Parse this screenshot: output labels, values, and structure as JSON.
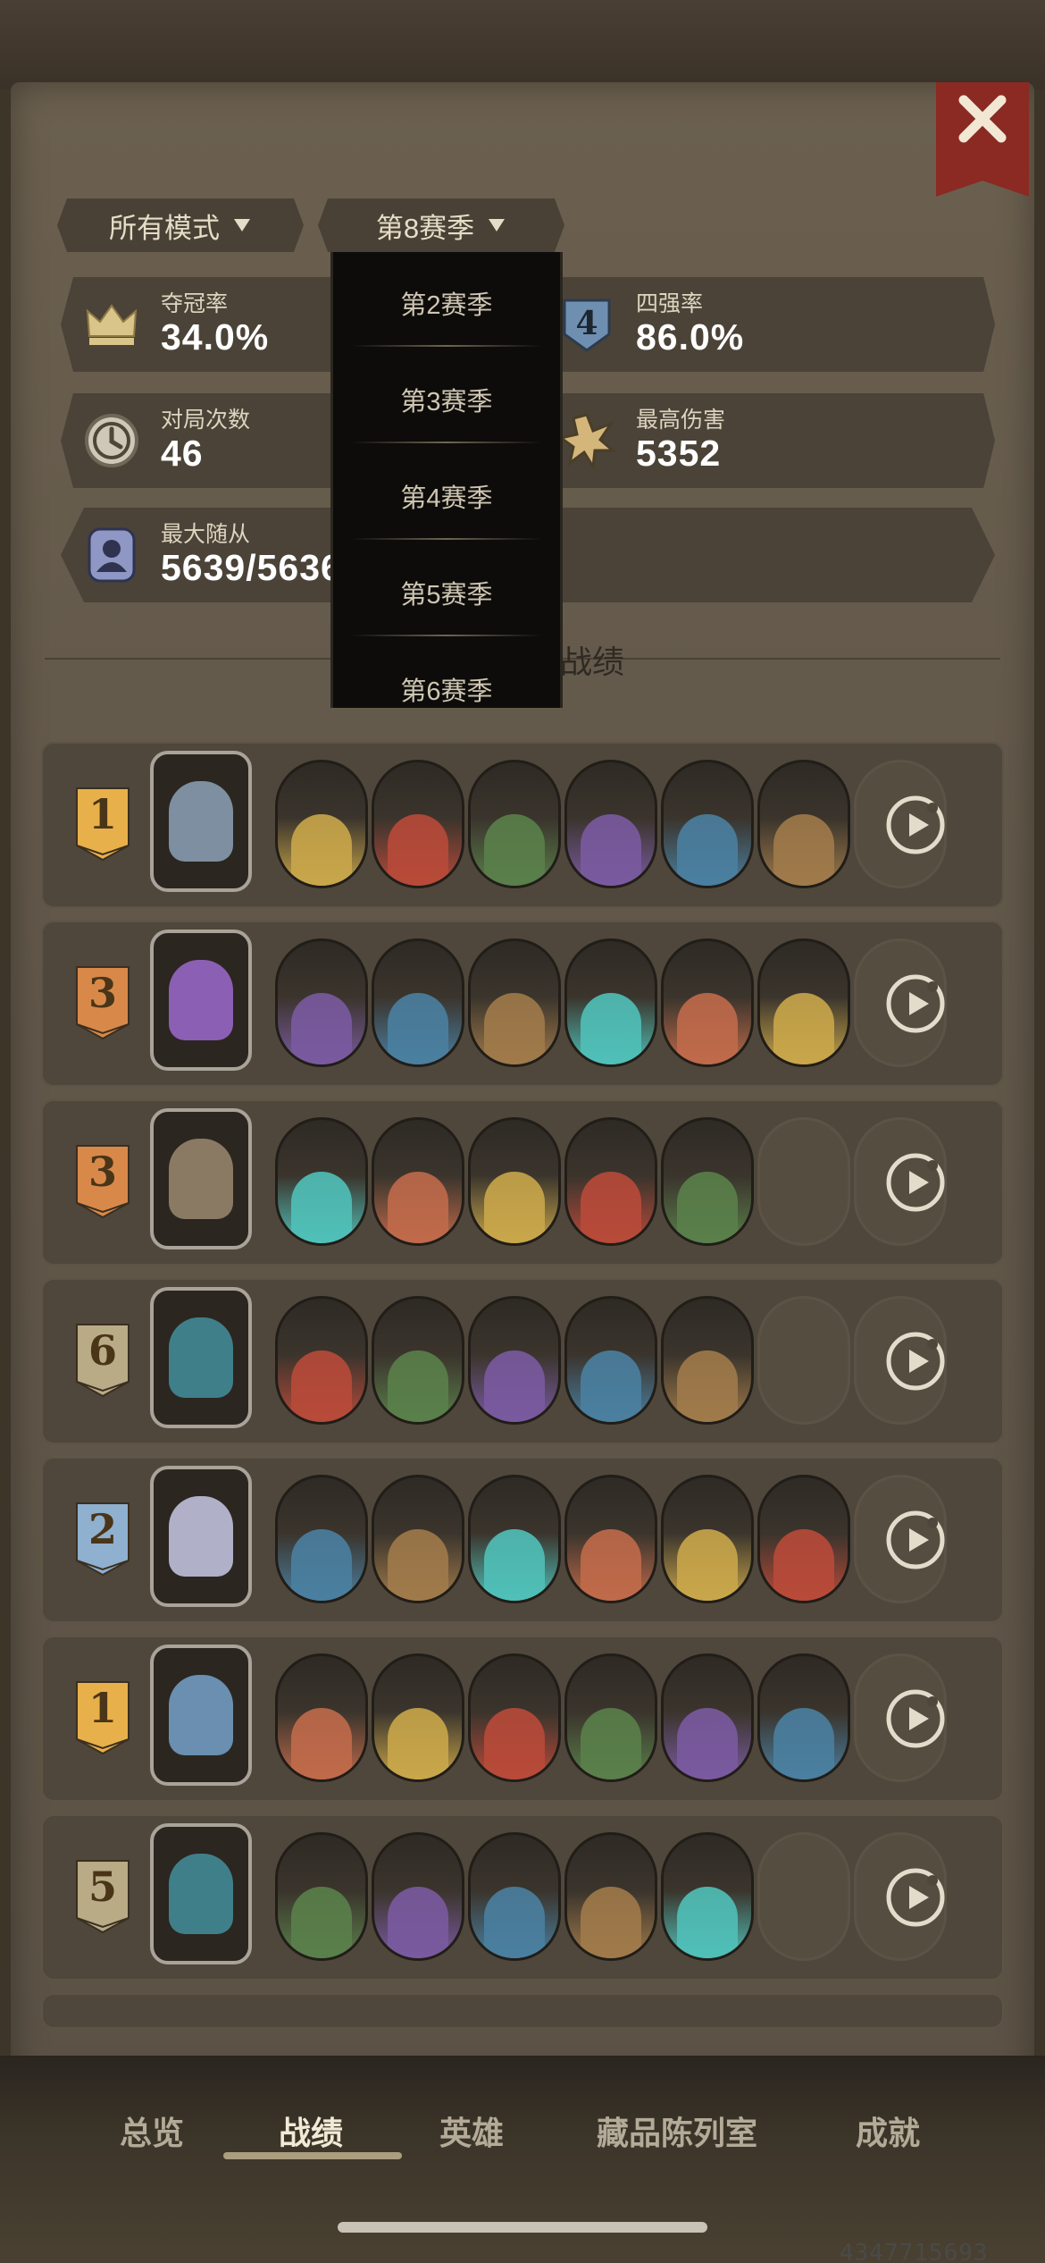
{
  "filters": {
    "mode_label": "所有模式",
    "season_label": "第8赛季"
  },
  "stats": {
    "win_rate": {
      "label": "夺冠率",
      "value": "34.0%"
    },
    "top4_rate": {
      "label": "四强率",
      "value": "86.0%"
    },
    "games": {
      "label": "对局次数",
      "value": "46"
    },
    "max_damage": {
      "label": "最高伤害",
      "value": "5352"
    },
    "max_minion": {
      "label": "最大随从",
      "value": "5639/5636"
    }
  },
  "section": {
    "title_visible": "的战绩"
  },
  "season_dropdown": {
    "options": [
      "第2赛季",
      "第3赛季",
      "第4赛季",
      "第5赛季",
      "第6赛季"
    ]
  },
  "matches": [
    {
      "rank": "1",
      "rank_color": "#e8b04a",
      "minions": 6
    },
    {
      "rank": "3",
      "rank_color": "#d8894a",
      "minions": 6
    },
    {
      "rank": "3",
      "rank_color": "#d8894a",
      "minions": 5
    },
    {
      "rank": "6",
      "rank_color": "#b8ab86",
      "minions": 5
    },
    {
      "rank": "2",
      "rank_color": "#8fb0cf",
      "minions": 6
    },
    {
      "rank": "1",
      "rank_color": "#e8b04a",
      "minions": 6
    },
    {
      "rank": "5",
      "rank_color": "#b8ab86",
      "minions": 5
    }
  ],
  "bottom_nav": {
    "items": [
      "总览",
      "战绩",
      "英雄",
      "藏品陈列室",
      "成就"
    ],
    "active": "战绩"
  },
  "watermark": "4347715693"
}
